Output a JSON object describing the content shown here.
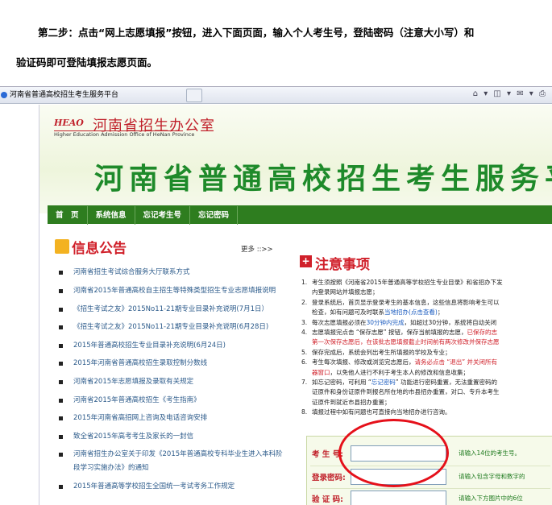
{
  "instructions": {
    "line1": "第二步：点击“网上志愿填报”按钮，进入下面页面，输入个人考生号，登陆密码（注意大小写）和",
    "line2": "验证码即可登陆填报志愿页面。"
  },
  "browser": {
    "tab_title": "河南省普通高校招生考生服务平台",
    "tools": "⌂ ▾ ◫ ▾ ✉ ▾ ⎙"
  },
  "site": {
    "logo_mark": "HEAO",
    "logo_cn": "河南省招生办公室",
    "logo_en": "Higher Education Admission Office of HeNan Province",
    "banner_title": "河南省普通高校招生考生服务平"
  },
  "nav": [
    "首　页",
    "系统信息",
    "忘记考生号",
    "忘记密码"
  ],
  "notices": {
    "title": "信息公告",
    "more": "更多 ::>>",
    "items": [
      "河南省招生考试综合服务大厅联系方式",
      "河南省2015年普通高校自主招生等特殊类型招生专业志愿填报说明",
      "《招生考试之友》2015No11-21期专业目录补充说明(7月1日）",
      "《招生考试之友》2015No11-21期专业目录补充说明(6月28日)",
      "2015年普通高校招生专业目录补充说明(6月24日)",
      "2015年河南省普通高校招生录取控制分数线",
      "河南省2015年志愿填报及录取有关规定",
      "河南省2015年普通高校招生《考生指南》",
      "2015年河南省高招网上咨询及电话咨询安排",
      "致全省2015年高考考生及家长的一封信",
      "河南省招生办公室关于印发《2015年普通高校专科毕业生进入本科阶段学习实施办法》的通知",
      "2015年普通高等学校招生全国统一考试考务工作规定"
    ]
  },
  "attention": {
    "title": "注意事项",
    "lines": [
      {
        "n": "1.",
        "segs": [
          {
            "t": "考生须按照《河南省2015年普通高等学校招生专业目录》和省招办下发"
          }
        ]
      },
      {
        "n": "",
        "segs": [
          {
            "t": "内登录网站并填报志愿；"
          }
        ]
      },
      {
        "n": "2.",
        "segs": [
          {
            "t": "登录系统后，首页显示登录考生的基本信息，这些信息将影响考生可以"
          }
        ]
      },
      {
        "n": "",
        "segs": [
          {
            "t": "检查，如有问题可及时联系"
          },
          {
            "t": "当地招办(点击查看)",
            "c": "b"
          },
          {
            "t": "；"
          }
        ]
      },
      {
        "n": "3.",
        "segs": [
          {
            "t": "每次志愿填报必须在"
          },
          {
            "t": "30分钟内完成",
            "c": "b"
          },
          {
            "t": "，如超过30分钟，系统将自动关闭"
          }
        ]
      },
      {
        "n": "4.",
        "segs": [
          {
            "t": "志愿填报完点击 “保存志愿” 按钮，保存当前填报的志愿，"
          },
          {
            "t": "已保存的志",
            "c": "r"
          }
        ]
      },
      {
        "n": "",
        "segs": [
          {
            "t": "第一次保存志愿后，在该批志愿填报截止时间前有两次修改并保存志愿",
            "c": "r"
          }
        ]
      },
      {
        "n": "5.",
        "segs": [
          {
            "t": "保存完成后，系统会列出考生所填报的学校及专业；"
          }
        ]
      },
      {
        "n": "6.",
        "segs": [
          {
            "t": "考生每次填报、修改或浏览完志愿后，"
          },
          {
            "t": "请务必点击 “退出” 并关闭所有",
            "c": "r"
          }
        ]
      },
      {
        "n": "",
        "segs": [
          {
            "t": "器窗口",
            "c": "r"
          },
          {
            "t": "，以免他人进行不利于考生本人的修改和信息收集；"
          }
        ]
      },
      {
        "n": "7.",
        "segs": [
          {
            "t": "如忘记密码，可利用 “"
          },
          {
            "t": "忘记密码",
            "c": "b"
          },
          {
            "t": "” 功能进行密码重置，无法重置密码的"
          }
        ]
      },
      {
        "n": "",
        "segs": [
          {
            "t": "证原件和身份证原件到报名所在地的市县招办重置，对口、专升本考生"
          }
        ]
      },
      {
        "n": "",
        "segs": [
          {
            "t": "证原件到就近市县招办重置；"
          }
        ]
      },
      {
        "n": "8.",
        "segs": [
          {
            "t": "填报过程中如有问题也可直接向当地招办进行咨询。"
          }
        ]
      }
    ]
  },
  "login": {
    "exam_label": "考 生 号:",
    "exam_hint": "请输入14位的考生号。",
    "pwd_label": "登录密码:",
    "pwd_hint": "请输入包含字母和数字的",
    "code_label": "验 证 码:",
    "code_hint": "请输入下方图片中的6位"
  },
  "colors": {
    "nav_bg": "#2e7d1f",
    "banner_green": "#1e8a2a",
    "accent_red": "#d0202a",
    "highlight_circle": "#e5101a"
  }
}
